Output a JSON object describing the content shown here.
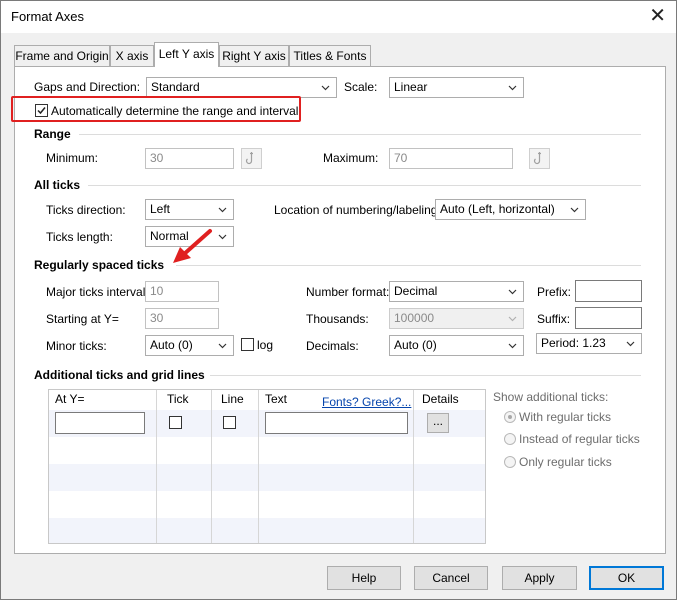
{
  "window": {
    "title": "Format Axes",
    "close_glyph": "✕"
  },
  "tabs": [
    {
      "label": "Frame and Origin"
    },
    {
      "label": "X axis"
    },
    {
      "label": "Left Y axis"
    },
    {
      "label": "Right Y axis"
    },
    {
      "label": "Titles & Fonts"
    }
  ],
  "active_tab": "Left Y axis",
  "top": {
    "gaps_label": "Gaps and Direction:",
    "gaps_value": "Standard",
    "scale_label": "Scale:",
    "scale_value": "Linear",
    "auto_range_label": "Automatically determine the range and interval",
    "auto_range_checked": true
  },
  "range": {
    "title": "Range",
    "minimum_label": "Minimum:",
    "minimum_value": "30",
    "maximum_label": "Maximum:",
    "maximum_value": "70"
  },
  "all_ticks": {
    "title": "All ticks",
    "direction_label": "Ticks direction:",
    "direction_value": "Left",
    "location_label": "Location of numbering/labeling:",
    "location_value": "Auto (Left, horizontal)",
    "length_label": "Ticks length:",
    "length_value": "Normal"
  },
  "regular": {
    "title": "Regularly spaced ticks",
    "major_label": "Major ticks interval:",
    "major_value": "10",
    "starting_label": "Starting at Y=",
    "starting_value": "30",
    "minor_label": "Minor ticks:",
    "minor_value": "Auto (0)",
    "log_label": "log",
    "number_format_label": "Number format:",
    "number_format_value": "Decimal",
    "thousands_label": "Thousands:",
    "thousands_value": "100000",
    "decimals_label": "Decimals:",
    "decimals_value": "Auto (0)",
    "prefix_label": "Prefix:",
    "prefix_value": "",
    "suffix_label": "Suffix:",
    "suffix_value": "",
    "period_value": "Period: 1.23"
  },
  "additional": {
    "title": "Additional ticks and grid lines",
    "columns": {
      "at_y": "At Y=",
      "tick": "Tick",
      "line": "Line",
      "text": "Text",
      "fonts_link": "Fonts? Greek?...",
      "details": "Details"
    },
    "row_at_y": "",
    "row_text": "",
    "details_button": "...",
    "show_label": "Show additional ticks:",
    "options": [
      {
        "label": "With regular ticks",
        "selected": true
      },
      {
        "label": "Instead of regular ticks",
        "selected": false
      },
      {
        "label": "Only regular ticks",
        "selected": false
      }
    ]
  },
  "buttons": {
    "help": "Help",
    "cancel": "Cancel",
    "apply": "Apply",
    "ok": "OK"
  },
  "colors": {
    "annotation": "#e02020",
    "accent": "#0078d7",
    "link": "#0645ad"
  }
}
